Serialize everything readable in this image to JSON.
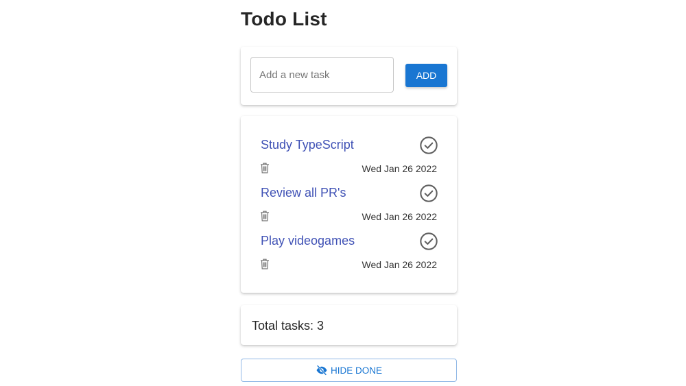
{
  "page_title": "Todo List",
  "add_form": {
    "placeholder": "Add a new task",
    "value": "",
    "add_button_label": "ADD"
  },
  "tasks": [
    {
      "name": "Study TypeScript",
      "date": "Wed Jan 26 2022"
    },
    {
      "name": "Review all PR's",
      "date": "Wed Jan 26 2022"
    },
    {
      "name": "Play videogames",
      "date": "Wed Jan 26 2022"
    }
  ],
  "total_label": "Total tasks: 3",
  "hide_done_label": "HIDE DONE",
  "icons": {
    "task_done": "check-circle-outline-icon",
    "task_delete": "trash-icon",
    "hide_done": "eye-off-icon"
  },
  "colors": {
    "primary": "#1976d2",
    "task_link": "#3f51b5"
  }
}
